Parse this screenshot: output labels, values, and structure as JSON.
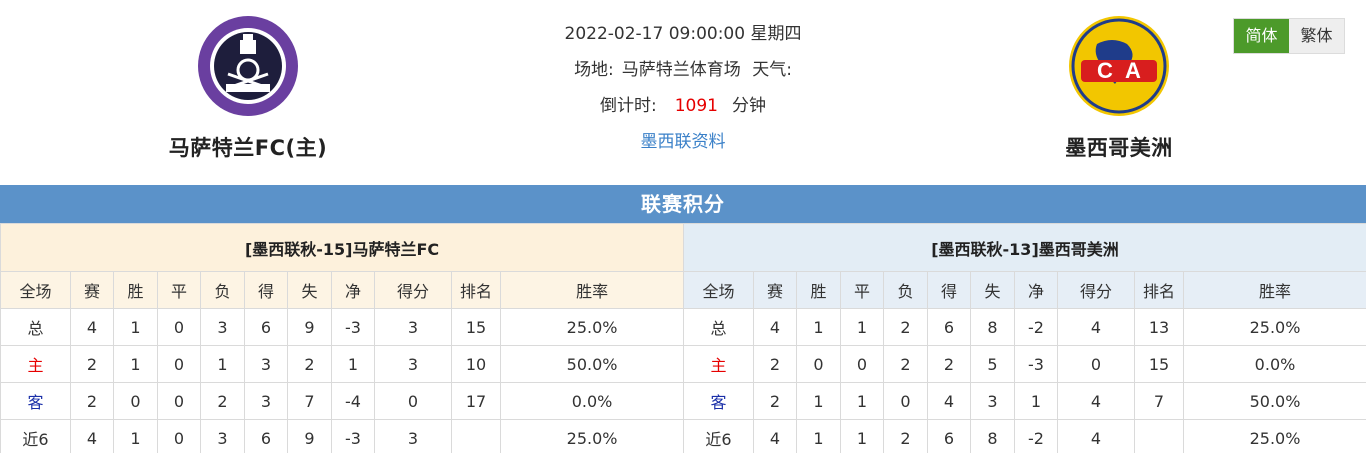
{
  "home_team": {
    "name": "马萨特兰FC(主)",
    "logo_text": "MAZATLAN FUTBOL CLUB",
    "logo_color": "#6a3fa0"
  },
  "away_team": {
    "name": "墨西哥美洲",
    "logo_text": "CA",
    "logo_color": "#f2c600"
  },
  "match": {
    "datetime": "2022-02-17 09:00:00 星期四",
    "venue_label": "场地:",
    "venue": "马萨特兰体育场",
    "weather_label": "天气:",
    "countdown_label": "倒计时:",
    "countdown_value": "1091",
    "countdown_unit": "分钟",
    "league_link": "墨西联资料"
  },
  "lang": {
    "simplified": "简体",
    "traditional": "繁体"
  },
  "section_title": "联赛积分",
  "columns": [
    "全场",
    "赛",
    "胜",
    "平",
    "负",
    "得",
    "失",
    "净",
    "得分",
    "排名",
    "胜率"
  ],
  "home_table": {
    "caption": "[墨西联秋-15]马萨特兰FC",
    "rows": [
      [
        "总",
        "4",
        "1",
        "0",
        "3",
        "6",
        "9",
        "-3",
        "3",
        "15",
        "25.0%"
      ],
      [
        "主",
        "2",
        "1",
        "0",
        "1",
        "3",
        "2",
        "1",
        "3",
        "10",
        "50.0%"
      ],
      [
        "客",
        "2",
        "0",
        "0",
        "2",
        "3",
        "7",
        "-4",
        "0",
        "17",
        "0.0%"
      ],
      [
        "近6",
        "4",
        "1",
        "0",
        "3",
        "6",
        "9",
        "-3",
        "3",
        "",
        "25.0%"
      ]
    ]
  },
  "away_table": {
    "caption": "[墨西联秋-13]墨西哥美洲",
    "rows": [
      [
        "总",
        "4",
        "1",
        "1",
        "2",
        "6",
        "8",
        "-2",
        "4",
        "13",
        "25.0%"
      ],
      [
        "主",
        "2",
        "0",
        "0",
        "2",
        "2",
        "5",
        "-3",
        "0",
        "15",
        "0.0%"
      ],
      [
        "客",
        "2",
        "1",
        "1",
        "0",
        "4",
        "3",
        "1",
        "4",
        "7",
        "50.0%"
      ],
      [
        "近6",
        "4",
        "1",
        "1",
        "2",
        "6",
        "8",
        "-2",
        "4",
        "",
        "25.0%"
      ]
    ]
  },
  "colors": {
    "header_bar": "#5b92c9",
    "home_label": "#e60000",
    "away_label": "#1a2fa8",
    "countdown": "#e60000",
    "link": "#3a80c8",
    "lang_active": "#4c9a2a"
  }
}
